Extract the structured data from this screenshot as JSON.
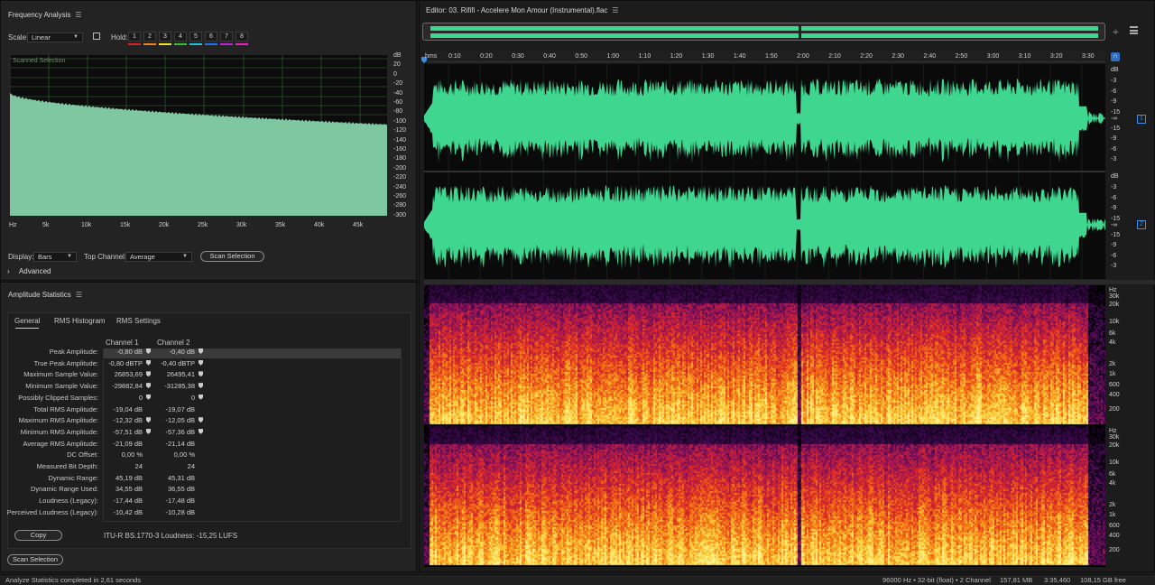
{
  "frequency_analysis": {
    "title": "Frequency Analysis",
    "scale_label": "Scale:",
    "scale_value": "Linear",
    "hold_label": "Hold:",
    "hold_buttons": [
      "1",
      "2",
      "3",
      "4",
      "5",
      "6",
      "7",
      "8"
    ],
    "hold_colors": [
      "#e02020",
      "#f08020",
      "#f0e020",
      "#30c030",
      "#20c0e0",
      "#2070f0",
      "#c020e0",
      "#f020c0"
    ],
    "graph_caption": "Scanned Selection",
    "x_ticks": [
      "Hz",
      "5k",
      "10k",
      "15k",
      "20k",
      "25k",
      "30k",
      "35k",
      "40k",
      "45k"
    ],
    "y_ticks": [
      "dB",
      "20",
      "0",
      "-20",
      "-40",
      "-60",
      "-80",
      "-100",
      "-120",
      "-140",
      "-160",
      "-180",
      "-200",
      "-220",
      "-240",
      "-260",
      "-280",
      "-300"
    ],
    "display_label": "Display:",
    "display_value": "Bars",
    "top_channel_label": "Top Channel:",
    "top_channel_value": "Average",
    "scan_button": "Scan Selection",
    "advanced_label": "Advanced",
    "spectrum_color": "#7fc7a0"
  },
  "amplitude_statistics": {
    "title": "Amplitude Statistics",
    "tabs": [
      "General",
      "RMS Histogram",
      "RMS Settings"
    ],
    "col_headers": [
      "Channel 1",
      "Channel 2"
    ],
    "rows": [
      {
        "label": "Peak Amplitude:",
        "c1": "-0,80 dB",
        "c2": "-0,40 dB"
      },
      {
        "label": "True Peak Amplitude:",
        "c1": "-0,80 dBTP",
        "c2": "-0,40 dBTP"
      },
      {
        "label": "Maximum Sample Value:",
        "c1": "26853,69",
        "c2": "26495,41"
      },
      {
        "label": "Minimum Sample Value:",
        "c1": "-29882,84",
        "c2": "-31285,38"
      },
      {
        "label": "Possibly Clipped Samples:",
        "c1": "0",
        "c2": "0"
      },
      {
        "label": "Total RMS Amplitude:",
        "c1": "-19,04 dB",
        "c2": "-19,07 dB"
      },
      {
        "label": "Maximum RMS Amplitude:",
        "c1": "-12,32 dB",
        "c2": "-12,05 dB"
      },
      {
        "label": "Minimum RMS Amplitude:",
        "c1": "-57,51 dB",
        "c2": "-57,36 dB"
      },
      {
        "label": "Average RMS Amplitude:",
        "c1": "-21,09 dB",
        "c2": "-21,14 dB"
      },
      {
        "label": "DC Offset:",
        "c1": "0,00 %",
        "c2": "0,00 %"
      },
      {
        "label": "Measured Bit Depth:",
        "c1": "24",
        "c2": "24"
      },
      {
        "label": "Dynamic Range:",
        "c1": "45,19 dB",
        "c2": "45,31 dB"
      },
      {
        "label": "Dynamic Range Used:",
        "c1": "34,55 dB",
        "c2": "36,55 dB"
      },
      {
        "label": "Loudness (Legacy):",
        "c1": "-17,44 dB",
        "c2": "-17,48 dB"
      },
      {
        "label": "Perceived Loudness (Legacy):",
        "c1": "-10,42 dB",
        "c2": "-10,28 dB"
      }
    ],
    "copy_button": "Copy",
    "itu_loudness": "ITU-R BS.1770-3 Loudness: -15,25 LUFS",
    "scan_button": "Scan Selection"
  },
  "editor": {
    "title": "Editor: 03. Rififi - Accelere Mon Amour (Instrumental).flac",
    "ruler_ticks": [
      "hms",
      "0:10",
      "0:20",
      "0:30",
      "0:40",
      "0:50",
      "1:00",
      "1:10",
      "1:20",
      "1:30",
      "1:40",
      "1:50",
      "2:00",
      "2:10",
      "2:20",
      "2:30",
      "2:40",
      "2:50",
      "3:00",
      "3:10",
      "3:20",
      "3:30"
    ],
    "db_ticks": [
      "dB",
      "-3",
      "-6",
      "-9",
      "-15",
      "-∞",
      "-15",
      "-9",
      "-6",
      "-3"
    ],
    "channel_badges": [
      "1",
      "2"
    ],
    "hz_ticks": [
      "Hz",
      "30k",
      "20k",
      "10k",
      "6k",
      "4k",
      "2k",
      "1k",
      "600",
      "400",
      "200"
    ],
    "wave_color": "#3fd690"
  },
  "status_bar": {
    "message": "Analyze Statistics completed in 2,61 seconds",
    "format": "96000 Hz • 32-bit (float) • 2 Channel",
    "size": "157,81 MB",
    "duration": "3:35,460",
    "free": "108,15 GB free"
  }
}
